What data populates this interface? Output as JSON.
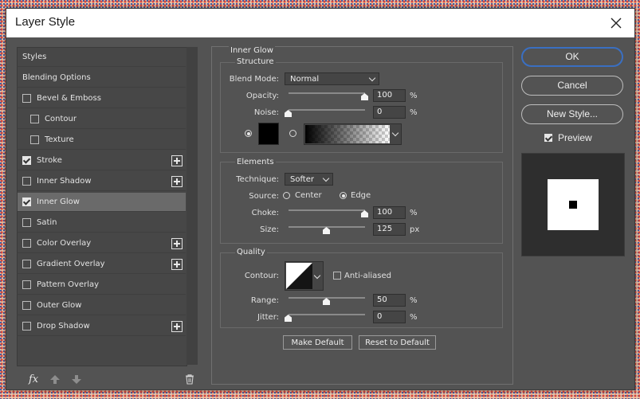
{
  "window": {
    "title": "Layer Style"
  },
  "sidebar": {
    "items": [
      {
        "label": "Styles",
        "has_checkbox": false,
        "checked": false,
        "has_plus": false,
        "selected": false
      },
      {
        "label": "Blending Options",
        "has_checkbox": false,
        "checked": false,
        "has_plus": false,
        "selected": false
      },
      {
        "label": "Bevel & Emboss",
        "has_checkbox": true,
        "checked": false,
        "has_plus": false,
        "selected": false
      },
      {
        "label": "Contour",
        "has_checkbox": true,
        "checked": false,
        "has_plus": false,
        "selected": false
      },
      {
        "label": "Texture",
        "has_checkbox": true,
        "checked": false,
        "has_plus": false,
        "selected": false
      },
      {
        "label": "Stroke",
        "has_checkbox": true,
        "checked": true,
        "has_plus": true,
        "selected": false
      },
      {
        "label": "Inner Shadow",
        "has_checkbox": true,
        "checked": false,
        "has_plus": true,
        "selected": false
      },
      {
        "label": "Inner Glow",
        "has_checkbox": true,
        "checked": true,
        "has_plus": false,
        "selected": true
      },
      {
        "label": "Satin",
        "has_checkbox": true,
        "checked": false,
        "has_plus": false,
        "selected": false
      },
      {
        "label": "Color Overlay",
        "has_checkbox": true,
        "checked": false,
        "has_plus": true,
        "selected": false
      },
      {
        "label": "Gradient Overlay",
        "has_checkbox": true,
        "checked": false,
        "has_plus": true,
        "selected": false
      },
      {
        "label": "Pattern Overlay",
        "has_checkbox": true,
        "checked": false,
        "has_plus": false,
        "selected": false
      },
      {
        "label": "Outer Glow",
        "has_checkbox": true,
        "checked": false,
        "has_plus": false,
        "selected": false
      },
      {
        "label": "Drop Shadow",
        "has_checkbox": true,
        "checked": false,
        "has_plus": true,
        "selected": false
      }
    ],
    "footer": {
      "fx_label": "fx",
      "icons": [
        "fx-icon",
        "move-up-icon",
        "move-down-icon",
        "trash-icon"
      ]
    }
  },
  "inner_glow": {
    "section_title": "Inner Glow",
    "structure": {
      "title": "Structure",
      "blend_mode_label": "Blend Mode:",
      "blend_mode_value": "Normal",
      "opacity_label": "Opacity:",
      "opacity_value": "100",
      "opacity_unit": "%",
      "opacity_level": 1.0,
      "noise_label": "Noise:",
      "noise_value": "0",
      "noise_unit": "%",
      "noise_level": 0.0,
      "color_radio_selected": true,
      "color_swatch": "#000000",
      "gradient_radio_selected": false
    },
    "elements": {
      "title": "Elements",
      "technique_label": "Technique:",
      "technique_value": "Softer",
      "source_label": "Source:",
      "source_center": "Center",
      "source_edge": "Edge",
      "source_selected": "Edge",
      "choke_label": "Choke:",
      "choke_value": "100",
      "choke_unit": "%",
      "choke_level": 1.0,
      "size_label": "Size:",
      "size_value": "125",
      "size_unit": "px",
      "size_level": 0.5
    },
    "quality": {
      "title": "Quality",
      "contour_label": "Contour:",
      "anti_aliased_label": "Anti-aliased",
      "anti_aliased_checked": false,
      "range_label": "Range:",
      "range_value": "50",
      "range_unit": "%",
      "range_level": 0.5,
      "jitter_label": "Jitter:",
      "jitter_value": "0",
      "jitter_unit": "%",
      "jitter_level": 0.0
    },
    "make_default_label": "Make Default",
    "reset_default_label": "Reset to Default"
  },
  "actions": {
    "ok_label": "OK",
    "cancel_label": "Cancel",
    "new_style_label": "New Style...",
    "preview_label": "Preview",
    "preview_checked": true
  },
  "colors": {
    "dialog_bg": "#535353",
    "accent": "#3a6fc2"
  }
}
